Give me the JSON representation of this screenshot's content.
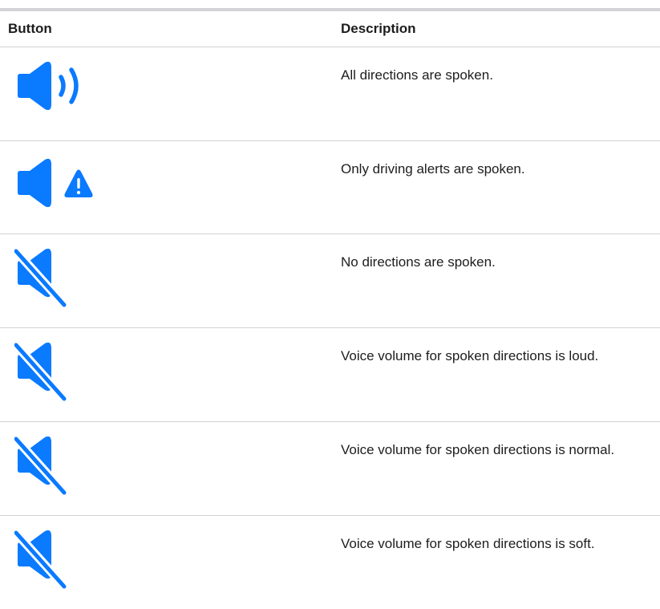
{
  "table": {
    "headers": {
      "button": "Button",
      "description": "Description"
    },
    "rows": [
      {
        "icon": "speaker-sound-icon",
        "description": "All directions are spoken."
      },
      {
        "icon": "speaker-alert-icon",
        "description": "Only driving alerts are spoken."
      },
      {
        "icon": "speaker-muted-icon",
        "description": "No directions are spoken."
      },
      {
        "icon": "speaker-muted-icon",
        "description": "Voice volume for spoken directions is loud."
      },
      {
        "icon": "speaker-muted-icon",
        "description": "Voice volume for spoken directions is normal."
      },
      {
        "icon": "speaker-muted-icon",
        "description": "Voice volume for spoken directions is soft."
      }
    ]
  },
  "colors": {
    "icon_blue": "#0a7aff",
    "divider": "#d2d2d7",
    "text": "#1d1d1f"
  }
}
